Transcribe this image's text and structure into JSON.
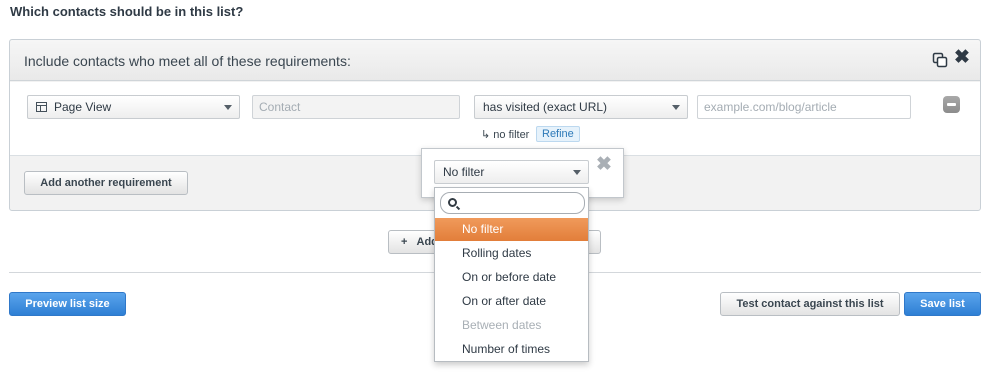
{
  "heading": "Which contacts should be in this list?",
  "panel": {
    "title": "Include contacts who meet all of these requirements:",
    "criteria": {
      "type_select": "Page View",
      "contact_field": "Contact",
      "condition_select": "has visited (exact URL)",
      "url_placeholder": "example.com/blog/article",
      "filter_note": "↳ no filter",
      "refine_label": "Refine"
    },
    "add_requirement_label": "Add another requirement"
  },
  "add_button": {
    "plus": "+",
    "label": "Add"
  },
  "popover": {
    "selected": "No filter",
    "options": [
      {
        "label": "No filter",
        "state": "active"
      },
      {
        "label": "Rolling dates",
        "state": "normal"
      },
      {
        "label": "On or before date",
        "state": "normal"
      },
      {
        "label": "On or after date",
        "state": "normal"
      },
      {
        "label": "Between dates",
        "state": "disabled"
      },
      {
        "label": "Number of times",
        "state": "normal"
      }
    ]
  },
  "footer": {
    "preview_label": "Preview list size",
    "test_label": "Test contact against this list",
    "save_label": "Save list"
  },
  "colors": {
    "primary_button": "#2e7fd4",
    "highlight": "#e8884a"
  }
}
